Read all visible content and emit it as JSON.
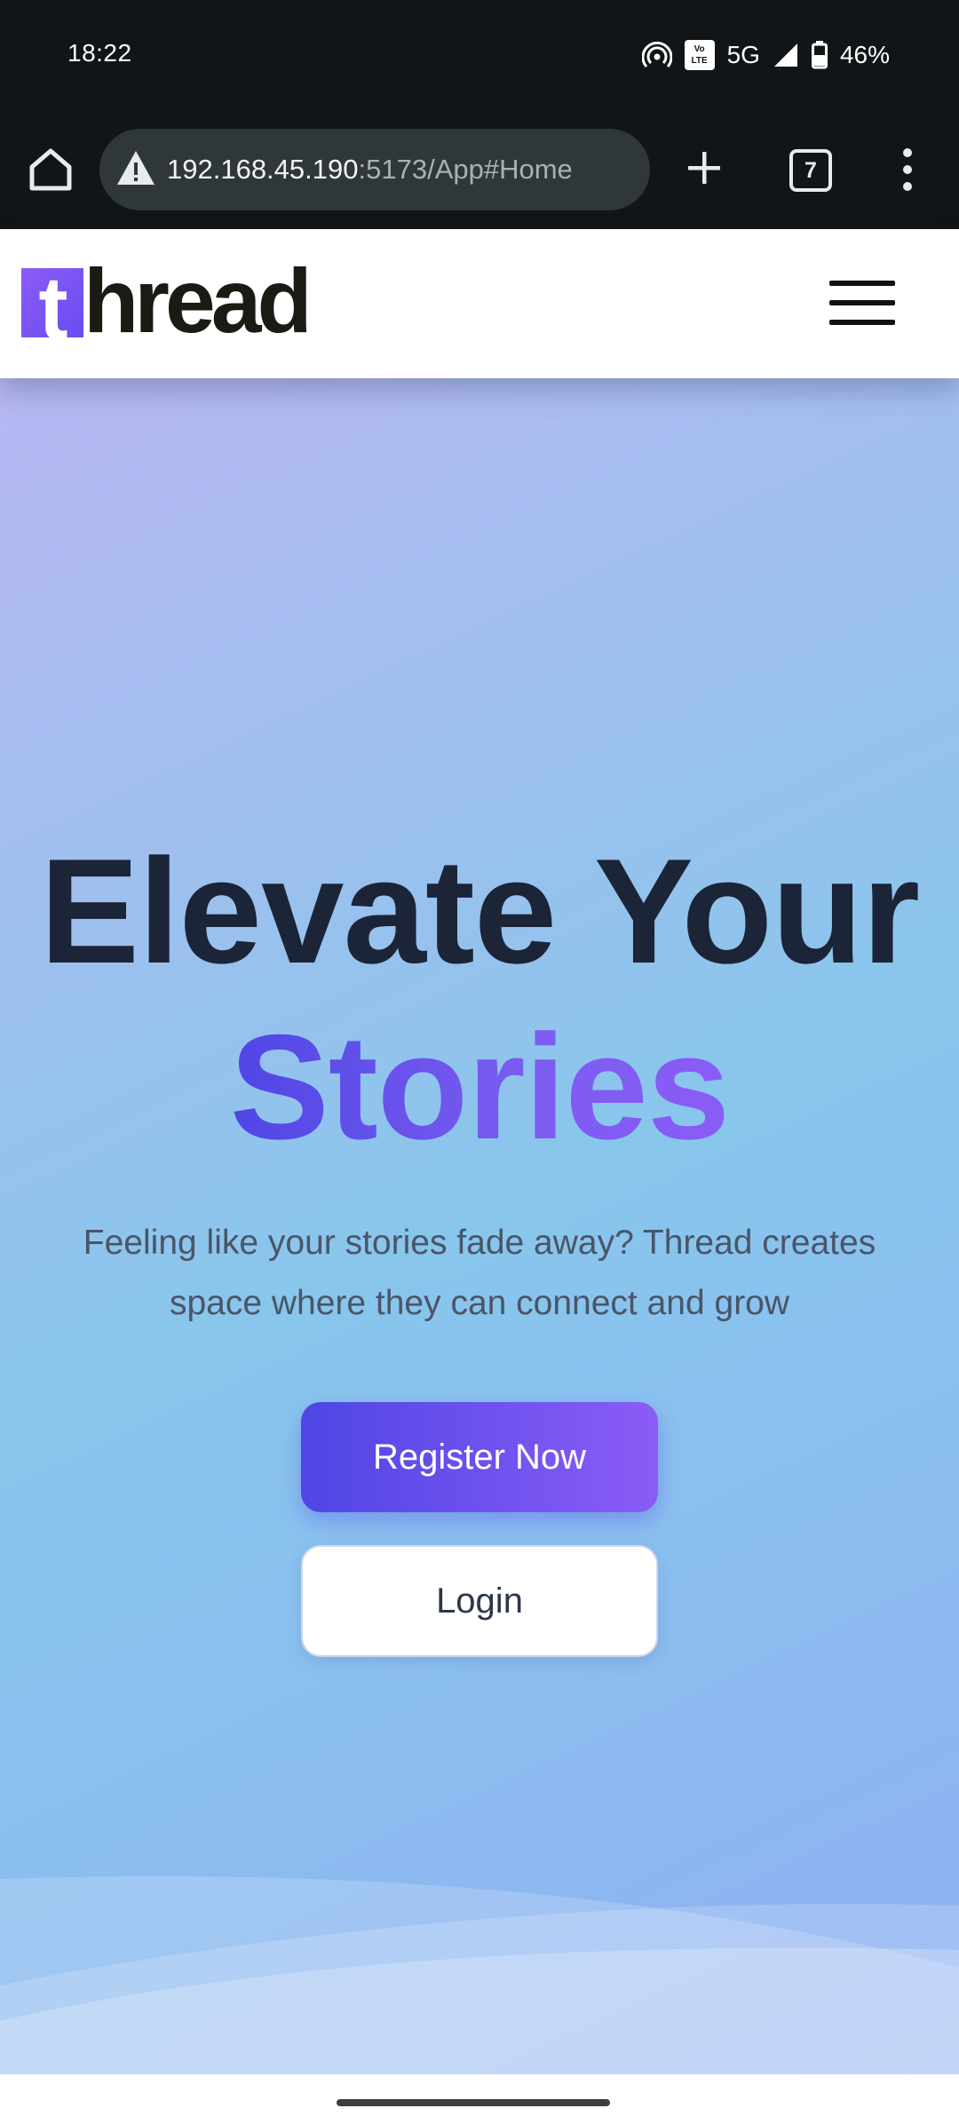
{
  "status_bar": {
    "time": "18:22",
    "network": "5G",
    "volte": "Vo LTE",
    "battery": "46%",
    "icons": [
      "hotspot-icon",
      "volte-icon",
      "signal-icon",
      "battery-icon"
    ]
  },
  "browser": {
    "url_host": "192.168.45.190",
    "url_path": ":5173/App#Home",
    "tab_count": "7",
    "icons": [
      "home-icon",
      "warning-icon",
      "plus-icon",
      "tabs-icon",
      "more-vert-icon"
    ]
  },
  "site_header": {
    "logo_first": "t",
    "logo_rest": "hread",
    "logo_accent": "#7c5cf0",
    "menu_icon": "hamburger-menu-icon"
  },
  "hero": {
    "title": "Elevate Your",
    "highlight": "Stories",
    "subtitle": "Feeling like your stories fade away? Thread creates space where they can connect and grow",
    "register_label": "Register Now",
    "login_label": "Login",
    "accent_start": "#4f46e5",
    "accent_end": "#8b5cf6"
  }
}
